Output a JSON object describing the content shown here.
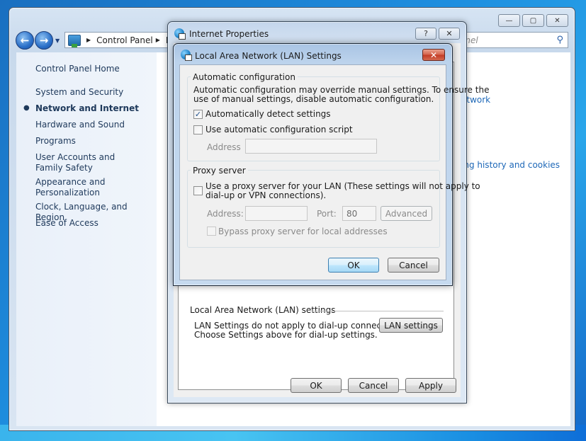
{
  "explorer": {
    "window_controls": {
      "minimize": "—",
      "maximize": "▢",
      "close": "✕"
    },
    "nav": {
      "back": "←",
      "forward": "→",
      "history_dropdown": "▼"
    },
    "breadcrumb": {
      "items": [
        "Control Panel",
        "N"
      ],
      "separator": "▶"
    },
    "search": {
      "placeholder": "anel",
      "icon": "🔍"
    },
    "sidebar": {
      "home": "Control Panel Home",
      "items": [
        {
          "label": "System and Security",
          "active": false
        },
        {
          "label": "Network and Internet",
          "active": true
        },
        {
          "label": "Hardware and Sound",
          "active": false
        },
        {
          "label": "Programs",
          "active": false
        },
        {
          "label": "User Accounts and Family Safety",
          "active": false
        },
        {
          "label": "Appearance and Personalization",
          "active": false
        },
        {
          "label": "Clock, Language, and Region",
          "active": false
        },
        {
          "label": "Ease of Access",
          "active": false
        }
      ],
      "bullet": "●"
    },
    "content_links": [
      "etwork",
      "ing history and cookies"
    ]
  },
  "internet_properties": {
    "title": "Internet Properties",
    "help": "?",
    "close": "✕",
    "lan_section": {
      "label": "Local Area Network (LAN) settings",
      "description_line1": "LAN Settings do not apply to dial-up connections.",
      "description_line2": "Choose Settings above for dial-up settings.",
      "button": "LAN settings"
    },
    "buttons": {
      "ok": "OK",
      "cancel": "Cancel",
      "apply": "Apply"
    }
  },
  "lan_settings": {
    "title": "Local Area Network (LAN) Settings",
    "close": "✕",
    "auto_config": {
      "label": "Automatic configuration",
      "description_line1": "Automatic configuration may override manual settings.  To ensure the",
      "description_line2": "use of manual settings, disable automatic configuration.",
      "auto_detect": {
        "label": "Automatically detect settings",
        "checked": true
      },
      "use_script": {
        "label": "Use automatic configuration script",
        "checked": false
      },
      "address_label": "Address",
      "address_value": ""
    },
    "proxy": {
      "label": "Proxy server",
      "use_proxy_line1": "Use a proxy server for your LAN (These settings will not apply to",
      "use_proxy_line2": "dial-up or VPN connections).",
      "use_proxy_checked": false,
      "address_label": "Address:",
      "address_value": "",
      "port_label": "Port:",
      "port_value": "80",
      "advanced": "Advanced",
      "bypass": {
        "label": "Bypass proxy server for local addresses",
        "checked": false
      }
    },
    "buttons": {
      "ok": "OK",
      "cancel": "Cancel"
    },
    "check_glyph": "✓"
  }
}
